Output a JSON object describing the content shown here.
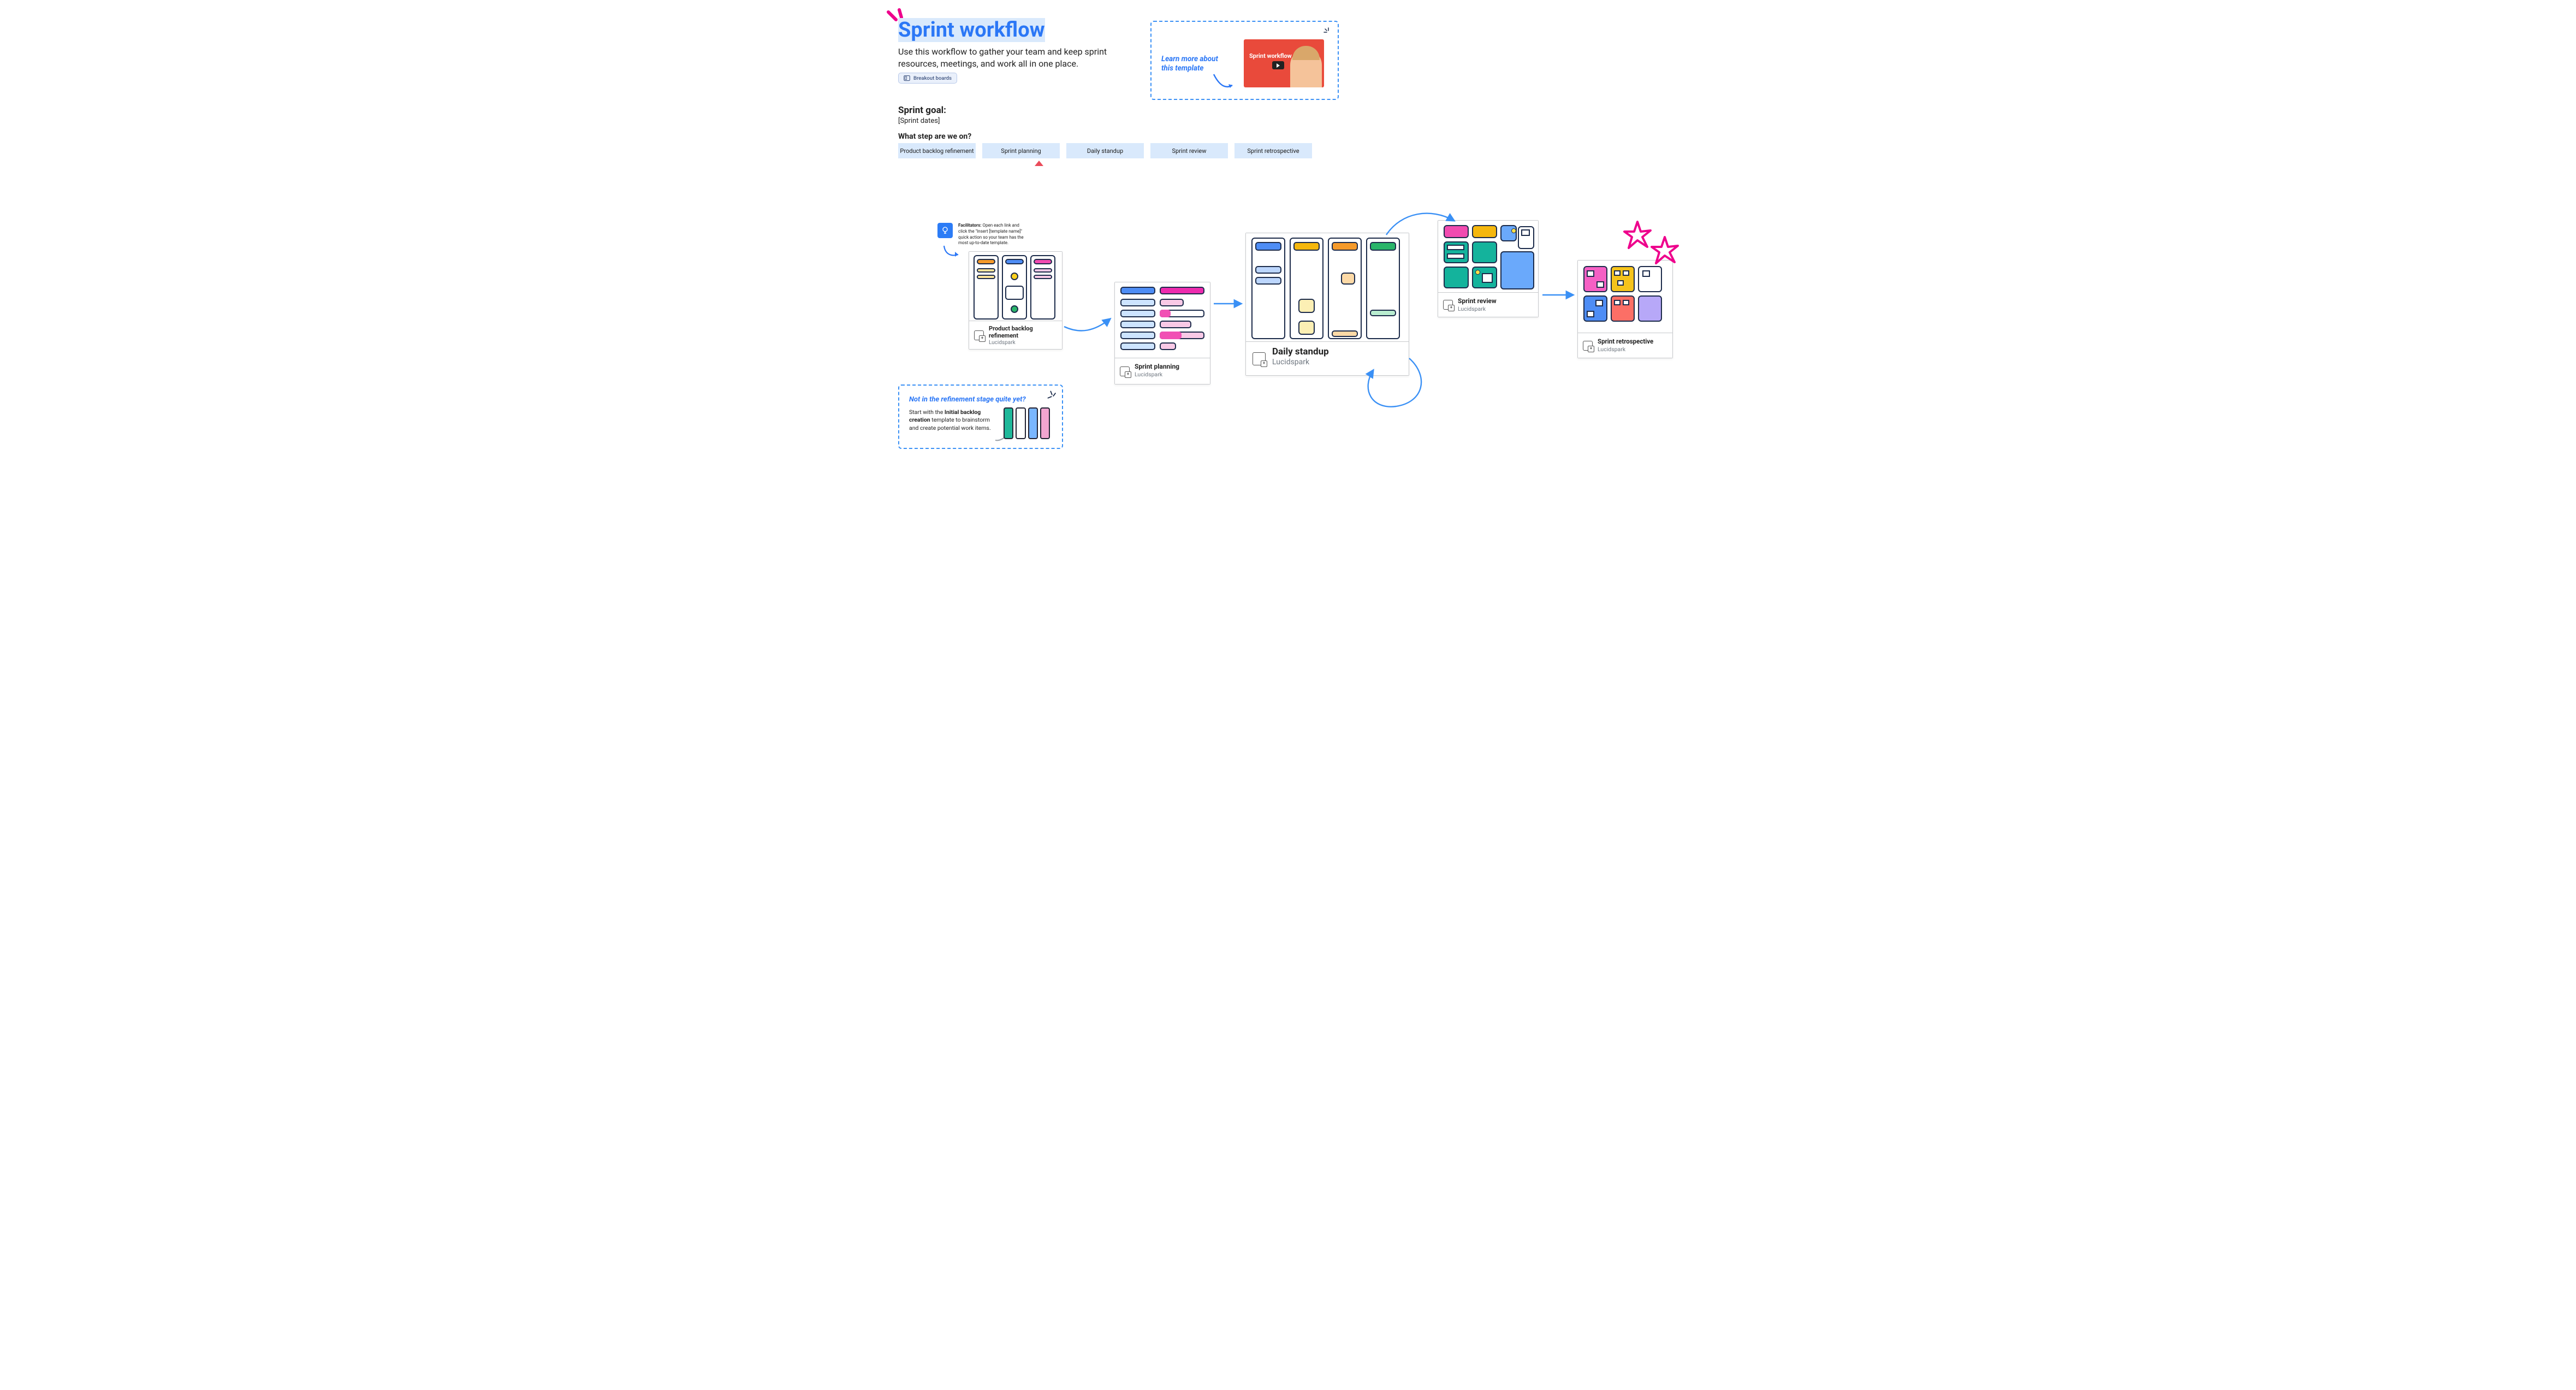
{
  "header": {
    "title": "Sprint workflow",
    "subtitle": "Use this workflow to gather your team and keep sprint resources, meetings, and work all in one place.",
    "pill_label": "Breakout boards"
  },
  "video": {
    "learn": "Learn more about this template",
    "card_text": "Sprint workflow template"
  },
  "goal": {
    "label": "Sprint goal:",
    "dates": "[Sprint dates]"
  },
  "progress": {
    "question": "What step are we on?",
    "steps": [
      "Product backlog refinement",
      "Sprint planning",
      "Daily standup",
      "Sprint review",
      "Sprint retrospective"
    ],
    "current_index": 1
  },
  "tip": {
    "lead": "Facilitators:",
    "body": "Open each link and click the \"Insert [template name]\" quick action so your team has the most up-to-date template."
  },
  "cards": {
    "pbr": {
      "title": "Product backlog refinement",
      "sub": "Lucidspark"
    },
    "sp": {
      "title": "Sprint planning",
      "sub": "Lucidspark"
    },
    "ds": {
      "title": "Daily standup",
      "sub": "Lucidspark"
    },
    "sr": {
      "title": "Sprint review",
      "sub": "Lucidspark"
    },
    "rt": {
      "title": "Sprint retrospective",
      "sub": "Lucidspark"
    }
  },
  "hint": {
    "heading": "Not in the refinement stage quite yet?",
    "body_pre": "Start with the ",
    "body_bold": "Initial backlog creation",
    "body_post": " template to brainstorm and create potential work items."
  }
}
